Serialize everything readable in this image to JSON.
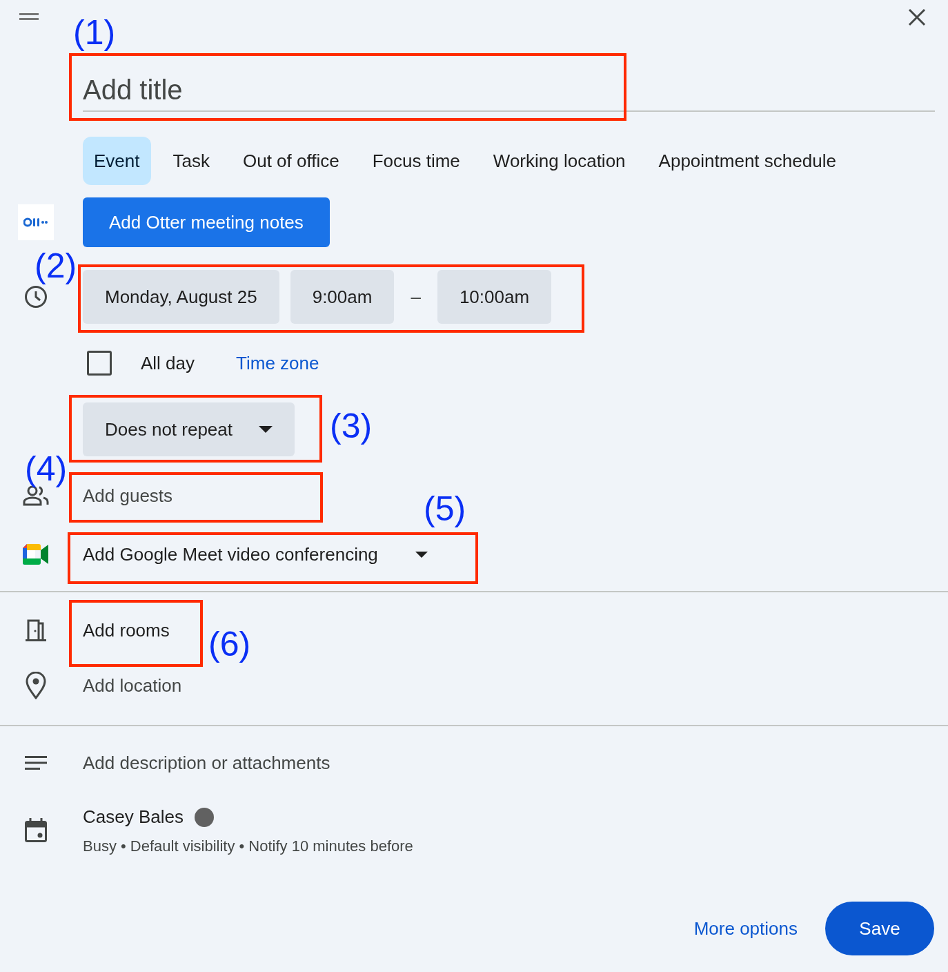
{
  "title": {
    "placeholder": "Add title"
  },
  "tabs": [
    {
      "label": "Event",
      "selected": true
    },
    {
      "label": "Task",
      "selected": false
    },
    {
      "label": "Out of office",
      "selected": false
    },
    {
      "label": "Focus time",
      "selected": false
    },
    {
      "label": "Working location",
      "selected": false
    },
    {
      "label": "Appointment schedule",
      "selected": false
    }
  ],
  "otter_button": "Add Otter meeting notes",
  "date": "Monday, August 25",
  "start_time": "9:00am",
  "separator": "–",
  "end_time": "10:00am",
  "all_day": {
    "label": "All day",
    "checked": false
  },
  "time_zone_link": "Time zone",
  "repeat": "Does not repeat",
  "guests": {
    "placeholder": "Add guests"
  },
  "conferencing": "Add Google Meet video conferencing",
  "rooms": "Add rooms",
  "location": {
    "placeholder": "Add location"
  },
  "description": "Add description or attachments",
  "calendar": {
    "owner": "Casey Bales",
    "color": "#616161",
    "details": "Busy • Default visibility • Notify 10 minutes before"
  },
  "footer": {
    "more_options": "More options",
    "save": "Save"
  },
  "annotations": [
    {
      "label": "(1)"
    },
    {
      "label": "(2)"
    },
    {
      "label": "(3)"
    },
    {
      "label": "(4)"
    },
    {
      "label": "(5)"
    },
    {
      "label": "(6)"
    }
  ]
}
